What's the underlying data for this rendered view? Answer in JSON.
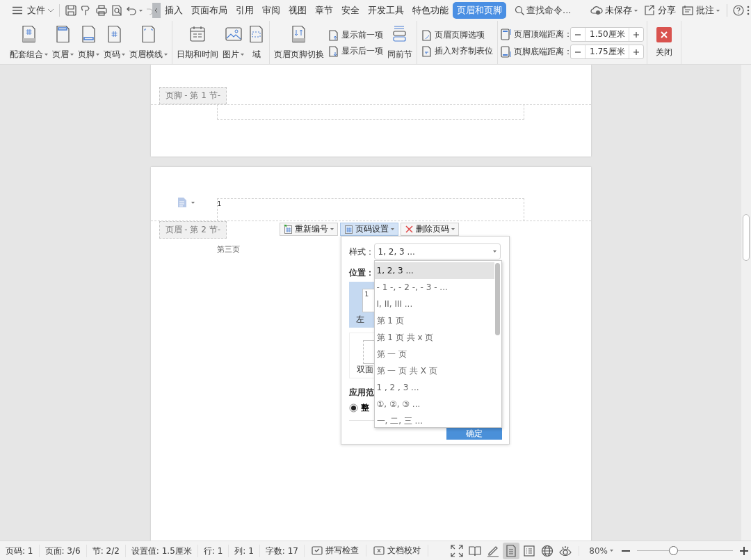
{
  "menu_bar": {
    "file_label": "文件",
    "tabs": [
      {
        "label": "插入",
        "selected": false
      },
      {
        "label": "页面布局",
        "selected": false
      },
      {
        "label": "引用",
        "selected": false
      },
      {
        "label": "审阅",
        "selected": false
      },
      {
        "label": "视图",
        "selected": false
      },
      {
        "label": "章节",
        "selected": false
      },
      {
        "label": "安全",
        "selected": false
      },
      {
        "label": "开发工具",
        "selected": false
      },
      {
        "label": "特色功能",
        "selected": false
      },
      {
        "label": "页眉和页脚",
        "selected": true
      }
    ],
    "search_placeholder": "查找命令...",
    "actions": [
      {
        "label": "未保存",
        "dropdown": true
      },
      {
        "label": "分享",
        "dropdown": false
      },
      {
        "label": "批注",
        "dropdown": true
      }
    ]
  },
  "ribbon": {
    "groups": [
      {
        "items": [
          {
            "kind": "large",
            "label": "配套组合",
            "dropdown": true
          },
          {
            "kind": "large",
            "label": "页眉",
            "dropdown": true
          },
          {
            "kind": "large",
            "label": "页脚",
            "dropdown": true
          },
          {
            "kind": "large",
            "label": "页码",
            "dropdown": true
          },
          {
            "kind": "large",
            "label": "页眉横线",
            "dropdown": true
          }
        ]
      },
      {
        "items": [
          {
            "kind": "large",
            "label": "日期和时间",
            "dropdown": false
          },
          {
            "kind": "large",
            "label": "图片",
            "dropdown": true
          },
          {
            "kind": "large",
            "label": "域",
            "dropdown": false
          }
        ]
      },
      {
        "items": [
          {
            "kind": "large",
            "label": "页眉页脚切换",
            "dropdown": false
          },
          {
            "kind": "stack",
            "items": [
              "显示前一项",
              "显示后一项"
            ]
          },
          {
            "kind": "large",
            "label": "同前节",
            "dropdown": false
          }
        ]
      },
      {
        "items": [
          {
            "kind": "stack",
            "items": [
              "页眉页脚选项",
              "插入对齐制表位"
            ]
          }
        ]
      },
      {
        "items": [
          {
            "kind": "spinners",
            "items": [
              {
                "label": "页眉顶端距离：",
                "value": "1.50厘米"
              },
              {
                "label": "页脚底端距离：",
                "value": "1.75厘米"
              }
            ]
          }
        ]
      },
      {
        "items": [
          {
            "kind": "close",
            "label": "关闭"
          }
        ]
      }
    ]
  },
  "document": {
    "page_1": {
      "footer_tag": "页脚 - 第 1 节-"
    },
    "page_2": {
      "header_tag": "页眉 - 第 2 节-",
      "header_text": "1",
      "body_text": "第三页",
      "toolbar": [
        {
          "label": "重新编号",
          "selected": false
        },
        {
          "label": "页码设置",
          "selected": true
        },
        {
          "label": "删除页码",
          "selected": false
        }
      ]
    }
  },
  "page_number_dialog": {
    "style_label": "样式：",
    "style_value": "1, 2, 3 ...",
    "position_label": "位置：",
    "positions": [
      {
        "label": "左",
        "preview": "1",
        "selected": true
      },
      {
        "label": "双面",
        "selected": false
      }
    ],
    "apply_label": "应用范",
    "apply_option": {
      "label": "整",
      "selected": true
    },
    "confirm": "确定",
    "style_options": [
      {
        "label": "1, 2, 3 ...",
        "selected": true
      },
      {
        "label": "- 1 -, - 2 -, - 3 - ...",
        "selected": false
      },
      {
        "label": "I, II, III ...",
        "selected": false
      },
      {
        "label": "第 1 页",
        "selected": false
      },
      {
        "label": "第 1 页 共 x 页",
        "selected": false
      },
      {
        "label": "第 一 页",
        "selected": false
      },
      {
        "label": "第 一 页 共 X 页",
        "selected": false
      },
      {
        "label": "1 , 2 , 3  ...",
        "selected": false
      },
      {
        "label": "①, ②, ③ ...",
        "selected": false
      },
      {
        "label": "一, 二, 三 ...",
        "selected": false
      }
    ]
  },
  "status_bar": {
    "items": [
      "页码: 1",
      "页面: 3/6",
      "节: 2/2",
      "设置值: 1.5厘米",
      "行: 1",
      "列: 1",
      "字数: 17"
    ],
    "tools": [
      "拼写检查",
      "文档校对"
    ],
    "views": [
      {
        "selected": false
      },
      {
        "selected": false
      },
      {
        "selected": false
      },
      {
        "selected": true
      },
      {
        "selected": false
      },
      {
        "selected": false
      },
      {
        "selected": false
      }
    ],
    "zoom": {
      "value": "80%",
      "level": 0.38
    }
  }
}
